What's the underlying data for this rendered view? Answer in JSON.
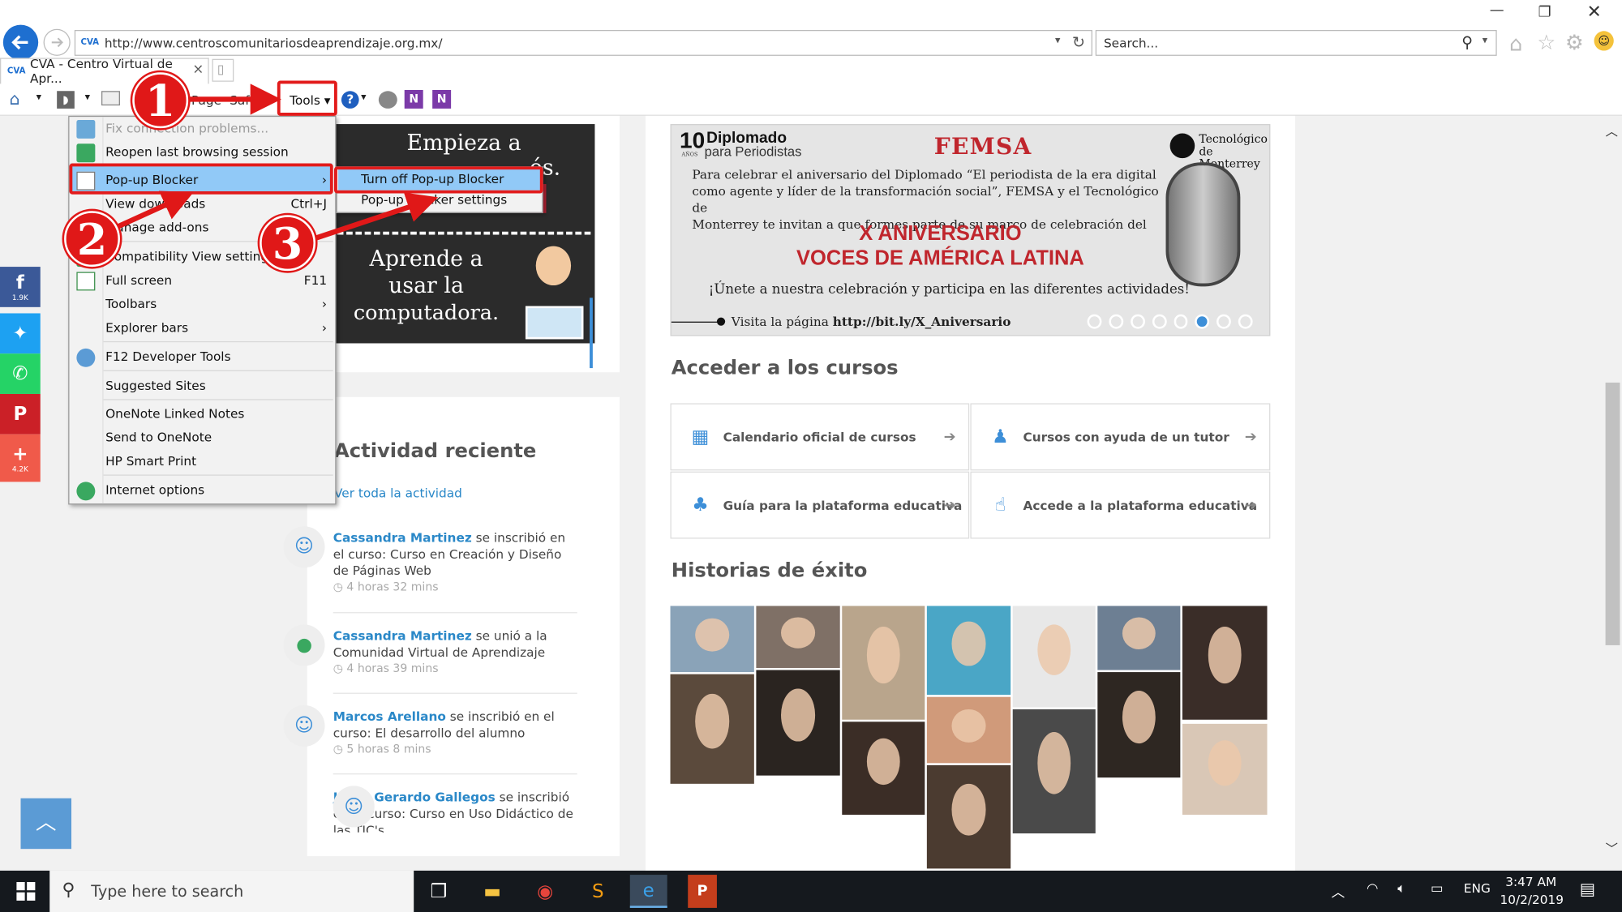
{
  "browser": {
    "url": "http://www.centroscomunitariosdeaprendizaje.org.mx/",
    "search_placeholder": "Search...",
    "tab_title": "CVA - Centro Virtual de Apr...",
    "tools_label": "Tools",
    "page_label": "Page",
    "safety_label": "Safety"
  },
  "tools_menu": {
    "items": [
      {
        "label": "Fix connection problems...",
        "shortcut": "",
        "disabled": true
      },
      {
        "label": "Reopen last browsing session",
        "shortcut": ""
      },
      {
        "label": "Pop-up Blocker",
        "shortcut": ">"
      },
      {
        "label": "View downloads",
        "shortcut": "Ctrl+J"
      },
      {
        "label": "Manage add-ons",
        "shortcut": ""
      },
      {
        "label": "Compatibility View settings",
        "shortcut": ""
      },
      {
        "label": "Full screen",
        "shortcut": "F11"
      },
      {
        "label": "Toolbars",
        "shortcut": ">"
      },
      {
        "label": "Explorer bars",
        "shortcut": ">"
      },
      {
        "label": "F12 Developer Tools",
        "shortcut": ""
      },
      {
        "label": "Suggested Sites",
        "shortcut": ""
      },
      {
        "label": "OneNote Linked Notes",
        "shortcut": ""
      },
      {
        "label": "Send to OneNote",
        "shortcut": ""
      },
      {
        "label": "HP Smart Print",
        "shortcut": ""
      },
      {
        "label": "Internet options",
        "shortcut": ""
      }
    ],
    "submenu": [
      "Turn off Pop-up Blocker",
      "Pop-up Blocker settings"
    ]
  },
  "steps": [
    "1",
    "2",
    "3"
  ],
  "chalk": {
    "line1": "Empieza a",
    "line2": "és.",
    "line3": "Aprende a",
    "line4": "usar la",
    "line5": "computadora."
  },
  "banner": {
    "years": "10",
    "years_small": "AÑOS",
    "diplomado": "Diplomado",
    "periodistas": "para Periodistas",
    "femsa": "FEMSA",
    "tec1": "Tecnológico",
    "tec2": "de Monterrey",
    "para1": "Para celebrar el aniversario del Diplomado “El periodista de la era digital",
    "para2": "como agente y líder de la transformación social”, FEMSA y el Tecnológico de",
    "para3": "Monterrey te invitan a que formes parte de su marco de celebración del",
    "headline1": "X ANIVERSARIO",
    "headline2": "VOCES DE AMÉRICA LATINA",
    "cta": "¡Únete a nuestra celebración y participa en las diferentes actividades!",
    "visit": "Visita la página",
    "link": "http://bit.ly/X_Aniversario"
  },
  "courses": {
    "title": "Acceder a los cursos",
    "items": [
      {
        "label": "Calendario oficial de cursos",
        "icon": "calendar-icon"
      },
      {
        "label": "Cursos con ayuda de un tutor",
        "icon": "users-icon"
      },
      {
        "label": "Guía para la plataforma educativa",
        "icon": "sitemap-icon"
      },
      {
        "label": "Accede a la plataforma educativa",
        "icon": "pointer-icon"
      }
    ]
  },
  "stories": {
    "title": "Historias de éxito"
  },
  "activity": {
    "title": "Actividad reciente",
    "view_all": "Ver toda la actividad",
    "items": [
      {
        "name": "Cassandra Martinez",
        "text": " se inscribió en el curso: Curso en Creación y Diseño de Páginas Web",
        "time": "4 horas 32 mins"
      },
      {
        "name": "Cassandra Martinez",
        "text": " se unió a la Comunidad Virtual de Aprendizaje",
        "time": "4 horas 39 mins"
      },
      {
        "name": "Marcos Arellano",
        "text": " se inscribió en el curso: El desarrollo del alumno",
        "time": "5 horas 8 mins"
      },
      {
        "name": "Jesus Gerardo Gallegos",
        "text": " se inscribió en el curso: Curso en Uso Didáctico de las TIC's",
        "time": ""
      }
    ]
  },
  "share": {
    "facebook_count": "1.9K",
    "plus_count": "4.2K"
  },
  "taskbar": {
    "search": "Type here to search",
    "lang": "ENG",
    "time": "3:47 AM",
    "date": "10/2/2019"
  },
  "colors": {
    "highlight": "#e21b1b",
    "menu_selected": "#91c9f7",
    "link": "#2a88c8",
    "banner_red": "#c0262d"
  }
}
